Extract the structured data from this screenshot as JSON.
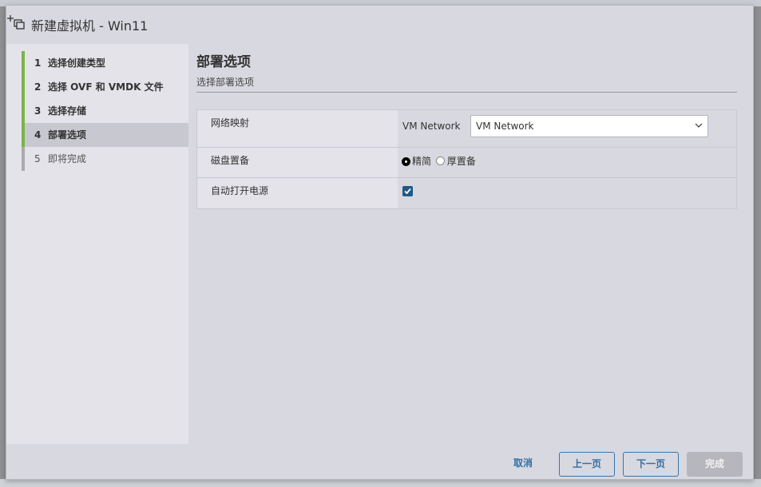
{
  "dialog": {
    "title": "新建虚拟机 - Win11",
    "icon": "new-vm-icon"
  },
  "steps": [
    {
      "num": "1",
      "label": "选择创建类型",
      "state": "done"
    },
    {
      "num": "2",
      "label": "选择 OVF 和 VMDK 文件",
      "state": "done"
    },
    {
      "num": "3",
      "label": "选择存储",
      "state": "done"
    },
    {
      "num": "4",
      "label": "部署选项",
      "state": "active"
    },
    {
      "num": "5",
      "label": "即将完成",
      "state": "pending"
    }
  ],
  "page": {
    "heading": "部署选项",
    "subheading": "选择部署选项"
  },
  "options": {
    "network_mapping": {
      "label": "网络映射",
      "source": "VM Network",
      "selected": "VM Network"
    },
    "disk_provisioning": {
      "label": "磁盘置备",
      "choices": [
        "精简",
        "厚置备"
      ],
      "selected": "精简"
    },
    "auto_power_on": {
      "label": "自动打开电源",
      "checked": true
    }
  },
  "footer": {
    "cancel": "取消",
    "back": "上一页",
    "next": "下一页",
    "finish": "完成"
  },
  "colors": {
    "accent": "#2f6fa6",
    "step_done": "#7ab547",
    "checkbox": "#1e5a86"
  }
}
